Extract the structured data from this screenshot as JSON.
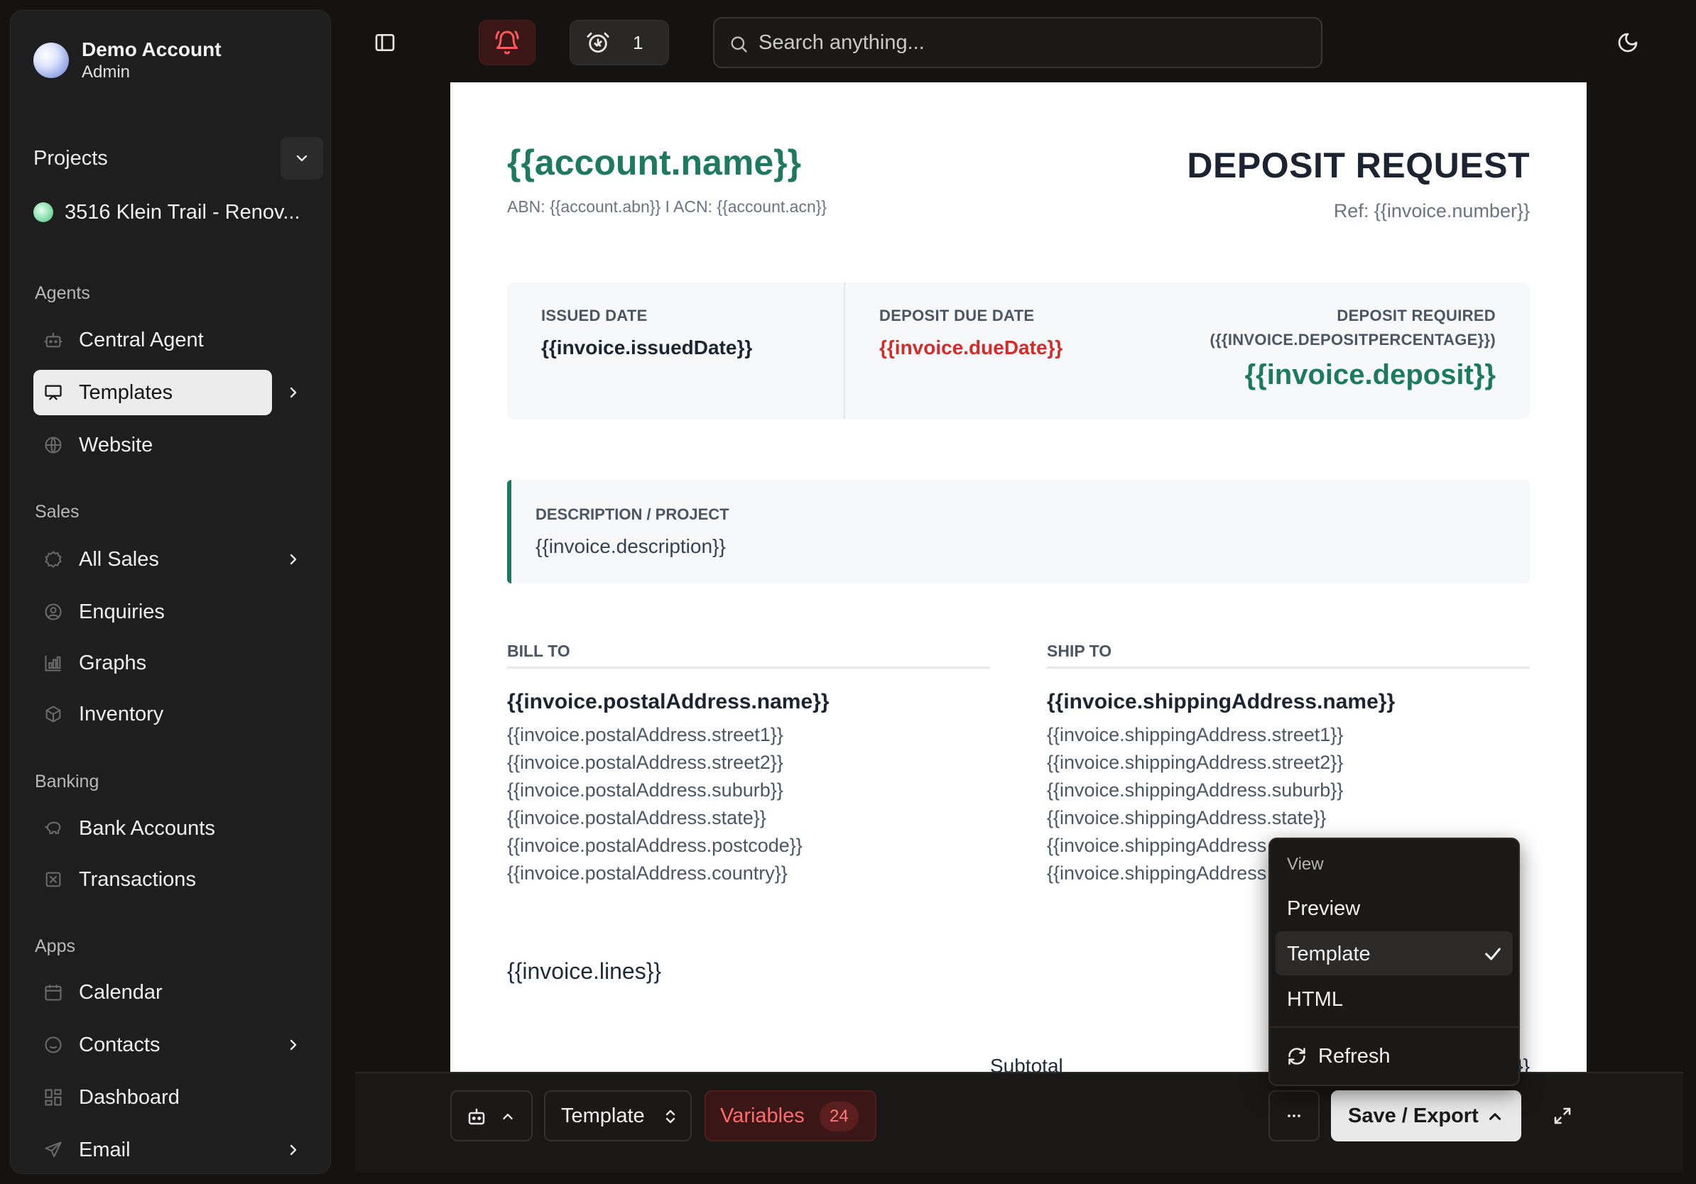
{
  "account": {
    "name": "Demo Account",
    "role": "Admin"
  },
  "projects": {
    "label": "Projects",
    "items": [
      {
        "label": "3516 Klein Trail - Renov..."
      }
    ]
  },
  "sections": {
    "agents": {
      "label": "Agents",
      "items": [
        {
          "label": "Central Agent",
          "icon": "bot-icon"
        },
        {
          "label": "Templates",
          "icon": "presentation-icon",
          "active": true
        },
        {
          "label": "Website",
          "icon": "globe-icon"
        }
      ]
    },
    "sales": {
      "label": "Sales",
      "items": [
        {
          "label": "All Sales",
          "icon": "badge-icon"
        },
        {
          "label": "Enquiries",
          "icon": "user-circle-icon"
        },
        {
          "label": "Graphs",
          "icon": "chart-icon"
        },
        {
          "label": "Inventory",
          "icon": "box-icon"
        }
      ]
    },
    "banking": {
      "label": "Banking",
      "items": [
        {
          "label": "Bank Accounts",
          "icon": "piggy-bank-icon"
        },
        {
          "label": "Transactions",
          "icon": "receipt-icon"
        }
      ]
    },
    "apps": {
      "label": "Apps",
      "items": [
        {
          "label": "Calendar",
          "icon": "calendar-icon"
        },
        {
          "label": "Contacts",
          "icon": "smile-icon"
        },
        {
          "label": "Dashboard",
          "icon": "dashboard-icon"
        },
        {
          "label": "Email",
          "icon": "send-icon"
        }
      ]
    }
  },
  "topbar": {
    "alarm_count": "1",
    "search_placeholder": "Search anything..."
  },
  "document": {
    "account_name": "{{account.name}}",
    "account_ids": "ABN: {{account.abn}} I ACN: {{account.acn}}",
    "title": "DEPOSIT REQUEST",
    "ref": "Ref: {{invoice.number}}",
    "issued_label": "ISSUED DATE",
    "issued_value": "{{invoice.issuedDate}}",
    "due_label": "DEPOSIT DUE DATE",
    "due_value": "{{invoice.dueDate}}",
    "required_label": "DEPOSIT REQUIRED",
    "required_pct": "({{INVOICE.DEPOSITPERCENTAGE}})",
    "deposit_value": "{{invoice.deposit}}",
    "desc_label": "DESCRIPTION / PROJECT",
    "desc_value": "{{invoice.description}}",
    "bill_to": {
      "heading": "BILL TO",
      "name": "{{invoice.postalAddress.name}}",
      "lines": [
        "{{invoice.postalAddress.street1}}",
        "{{invoice.postalAddress.street2}}",
        "{{invoice.postalAddress.suburb}}",
        "{{invoice.postalAddress.state}}",
        "{{invoice.postalAddress.postcode}}",
        "{{invoice.postalAddress.country}}"
      ]
    },
    "ship_to": {
      "heading": "SHIP TO",
      "name": "{{invoice.shippingAddress.name}}",
      "lines": [
        "{{invoice.shippingAddress.street1}}",
        "{{invoice.shippingAddress.street2}}",
        "{{invoice.shippingAddress.suburb}}",
        "{{invoice.shippingAddress.state}}",
        "{{invoice.shippingAddress",
        "{{invoice.shippingAddress"
      ]
    },
    "lines_placeholder": "{{invoice.lines}}",
    "subtotal_label": "Subtotal",
    "subtotal_value": "}}"
  },
  "toolbar": {
    "template_label": "Template",
    "variables_label": "Variables",
    "variables_count": "24",
    "save_label": "Save / Export"
  },
  "menu": {
    "heading": "View",
    "items": [
      {
        "label": "Preview"
      },
      {
        "label": "Template",
        "selected": true
      },
      {
        "label": "HTML"
      }
    ],
    "refresh_label": "Refresh"
  }
}
